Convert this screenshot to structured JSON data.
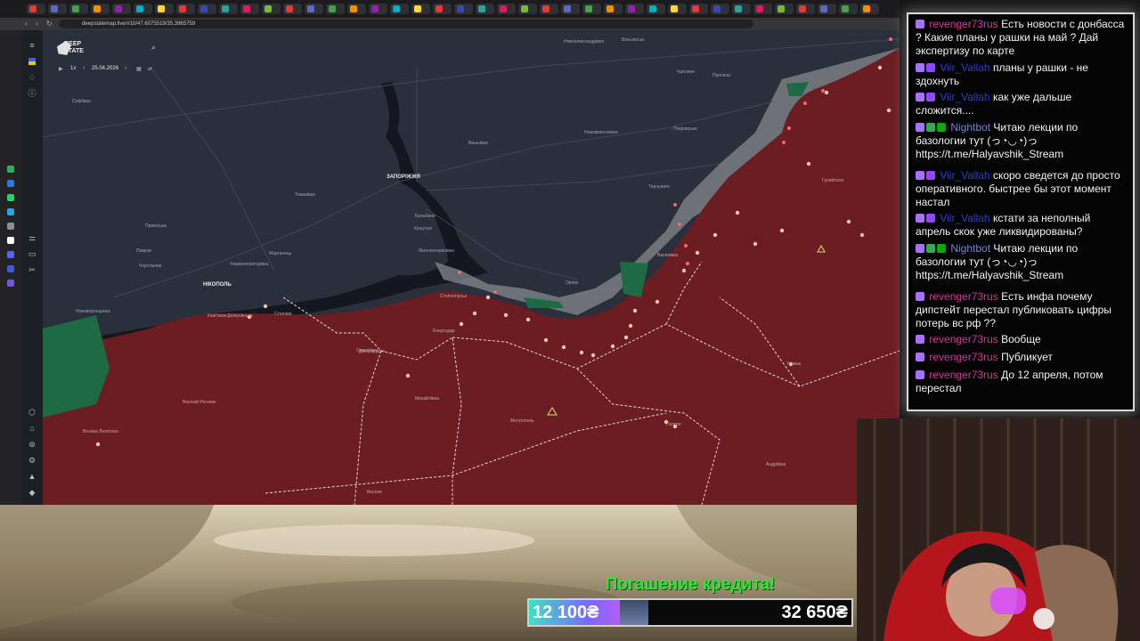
{
  "browser": {
    "url": "deepstatemap.live/#10/47.6075519/35.3965759",
    "tab_icon_colors": [
      "#e53935",
      "#5c6bc0",
      "#43a047",
      "#fb8c00",
      "#8e24aa",
      "#00acc1",
      "#fdd835",
      "#e53935",
      "#3949ab",
      "#26a69a",
      "#d81b60",
      "#7cb342"
    ]
  },
  "app": {
    "logo_line1": "DEEP",
    "logo_line2": "STATE",
    "speed": "1x",
    "date": "25.04.2026"
  },
  "map": {
    "cities": [
      {
        "id": "zaporizhzhia",
        "name": "ЗАПОРІЖЖЯ"
      },
      {
        "id": "nikopol",
        "name": "НІКОПОЛЬ"
      }
    ],
    "towns": [
      "Софіївка",
      "Томаківка",
      "Приміська",
      "Покров",
      "Чортомлик",
      "Червоногригорівка",
      "Марганець",
      "Балабине",
      "Кушугум",
      "Малокатеринівка",
      "Степногірськ",
      "Кам'янка-Дніпровська",
      "Нововоронцовка",
      "Велика Лепетиха",
      "Верхній Рогачик",
      "Михайлівка",
      "Мелітополь",
      "Олексіївка",
      "Оріхів",
      "Гуляйполе",
      "Новомиколаївка",
      "Покровське",
      "Чаплине",
      "Просяна",
      "Тернуватe",
      "Вільнянськ",
      "Новоолександрівка",
      "Вишнівка",
      "Василівка",
      "Токмак",
      "Пологи",
      "Андріївка",
      "Веселе",
      "Степове",
      "Дніпрорудне",
      "Енергодар"
    ],
    "colors": {
      "free": "#2a303b",
      "occupied": "#6b1d22",
      "contested": "#8a8e94",
      "liberated": "#1e6a45",
      "river": "#121720"
    }
  },
  "chat": {
    "messages": [
      {
        "user": "revenger73rus",
        "text": "Есть новости с донбасса ? Какие планы у рашки на май ? Дай экспертизу по карте",
        "badges": [
          "#a970ff"
        ]
      },
      {
        "user": "Viir_Vallah",
        "text": "планы у рашки - не здохнуть",
        "badges": [
          "#a970ff",
          "#9146ff"
        ]
      },
      {
        "user": "Viir_Vallah",
        "text": "как уже дальше сложится....",
        "badges": [
          "#a970ff",
          "#9146ff"
        ]
      },
      {
        "user": "Nightbot",
        "text": "Читаю лекции по базологии тут (っ◔◡◔)っ https://t.me/Halyavshik_Stream",
        "badges": [
          "#a970ff",
          "#34a853",
          "#00ad03"
        ]
      },
      {
        "user": "Viir_Vallah",
        "text": "скоро сведется до просто оперативного. быстрее бы этот момент настал",
        "badges": [
          "#a970ff",
          "#9146ff"
        ]
      },
      {
        "user": "Viir_Vallah",
        "text": "кстати за неполный апрель скок уже ликвидированы?",
        "badges": [
          "#a970ff",
          "#9146ff"
        ]
      },
      {
        "user": "Nightbot",
        "text": "Читаю лекции по базологии тут (っ◔◡◔)っ https://t.me/Halyavshik_Stream",
        "badges": [
          "#a970ff",
          "#34a853",
          "#00ad03"
        ]
      },
      {
        "user": "revenger73rus",
        "text": "Есть инфа почему дипстейт перестал публиковать цифры потерь вс рф ??",
        "badges": [
          "#a970ff"
        ]
      },
      {
        "user": "revenger73rus",
        "text": "Вообще",
        "badges": [
          "#a970ff"
        ]
      },
      {
        "user": "revenger73rus",
        "text": "Публикует",
        "badges": [
          "#a970ff"
        ]
      },
      {
        "user": "revenger73rus",
        "text": "До 12 апреля, потом перестал",
        "badges": [
          "#a970ff"
        ]
      }
    ]
  },
  "donation": {
    "title": "Погашение кредита!",
    "current": "12 100₴",
    "goal": "32 650₴",
    "progress": 0.37
  }
}
